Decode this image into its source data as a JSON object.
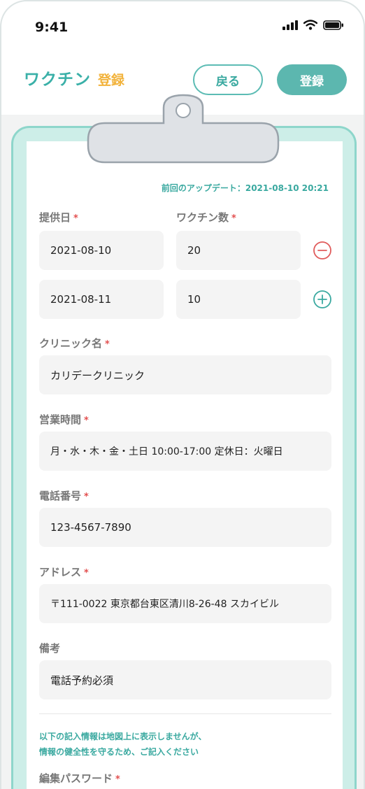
{
  "status": {
    "time": "9:41"
  },
  "header": {
    "title_main": "ワクチン",
    "title_sub": "登録",
    "back_label": "戻る",
    "register_label": "登録"
  },
  "form": {
    "last_update": "前回のアップデート：2021-08-10  20:21",
    "labels": {
      "date": "提供日",
      "count": "ワクチン数",
      "clinic": "クリニック名",
      "hours": "営業時間",
      "phone": "電話番号",
      "address": "アドレス",
      "remarks": "備考",
      "password": "編集パスワード"
    },
    "required_mark": "*",
    "rows": [
      {
        "date": "2021-08-10",
        "count": "20"
      },
      {
        "date": "2021-08-11",
        "count": "10"
      }
    ],
    "clinic": "カリデークリニック",
    "hours": "月・水・木・金・土日 10:00-17:00 定休日：火曜日",
    "phone": "123-4567-7890",
    "address": "〒111-0022 東京都台東区清川8-26-48 スカイビル",
    "remarks": "電話予約必須",
    "note_line1": "以下の記入情報は地図上に表示しませんが、",
    "note_line2": "情報の健全性を守るため、ご記入ください"
  },
  "colors": {
    "accent": "#3ab0a8",
    "accent_sub": "#f2b33c",
    "board": "#cdeee8",
    "required": "#e34f4f"
  },
  "icons": [
    "signal-icon",
    "wifi-icon",
    "battery-icon",
    "minus-circle-icon",
    "plus-circle-icon",
    "clip-icon"
  ]
}
